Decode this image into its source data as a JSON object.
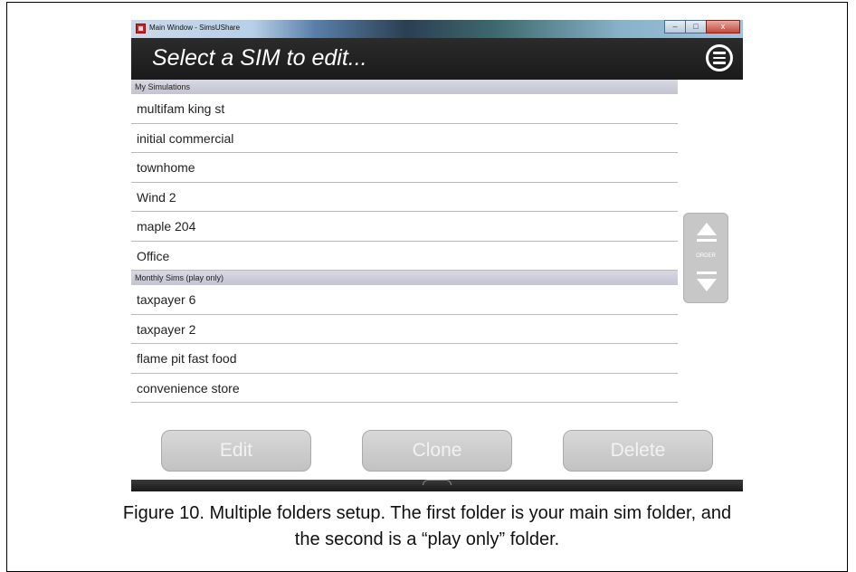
{
  "window": {
    "title": "Main Window - SimsUShare",
    "controls": {
      "minimize": "–",
      "maximize": "□",
      "close": "x"
    }
  },
  "header": {
    "title": "Select a SIM to edit...",
    "menu_icon": "hamburger-circle-icon"
  },
  "sections": [
    {
      "label": "My Simulations",
      "items": [
        "multifam king st",
        "initial commercial",
        "townhome",
        "Wind 2",
        "maple 204",
        "Office"
      ]
    },
    {
      "label": "Monthly Sims (play only)",
      "items": [
        "taxpayer 6",
        "taxpayer 2",
        "flame pit fast food",
        "convenience store"
      ]
    }
  ],
  "order_control": {
    "label": "ORDER"
  },
  "buttons": {
    "edit": "Edit",
    "clone": "Clone",
    "delete": "Delete"
  },
  "caption": {
    "line1": "Figure 10. Multiple folders setup. The first folder is your main sim folder, and",
    "line2": "the second is a “play only” folder."
  }
}
